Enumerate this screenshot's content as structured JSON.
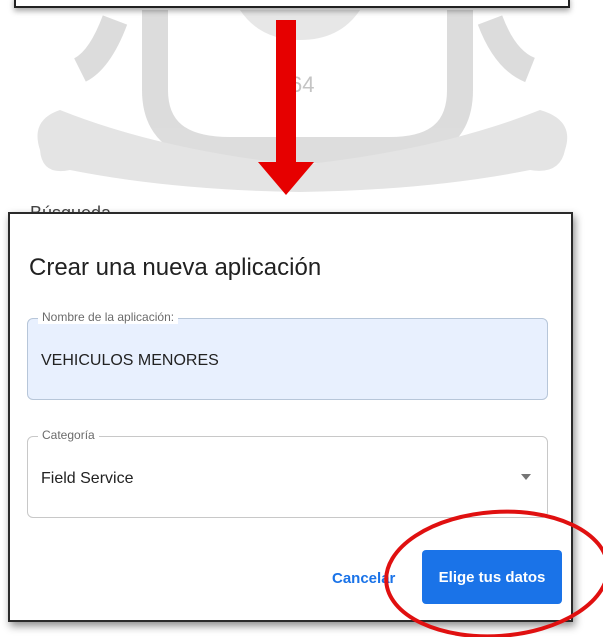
{
  "background": {
    "watermark_text": "64",
    "partial_label": "Búsqueda"
  },
  "dialog": {
    "title": "Crear una nueva aplicación",
    "app_name_field": {
      "label": "Nombre de la aplicación:",
      "value": "VEHICULOS MENORES"
    },
    "category_field": {
      "label": "Categoría",
      "value": "Field Service",
      "icon": "dropdown-arrow-icon"
    },
    "cancel_label": "Cancelar",
    "confirm_label": "Elige tus datos"
  },
  "colors": {
    "accent": "#1a73e8",
    "annotation_arrow": "#e60000",
    "annotation_circle": "#e01010",
    "field_fill": "#e8f0fe"
  }
}
